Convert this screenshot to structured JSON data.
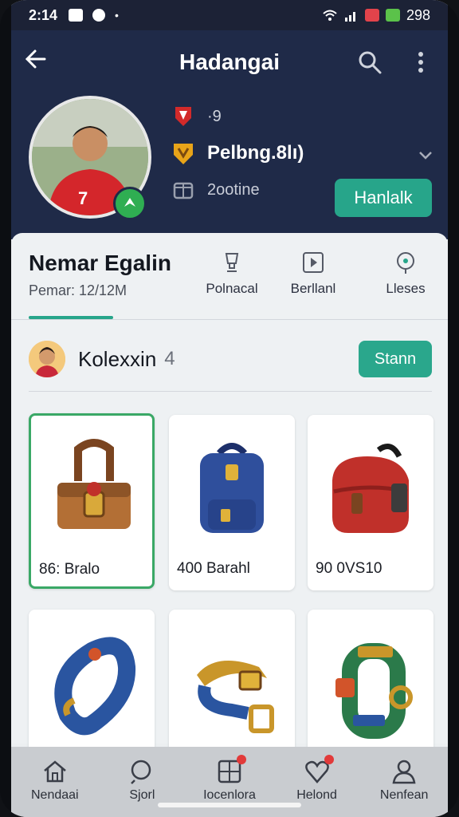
{
  "status_bar": {
    "time": "2:14",
    "battery": "298"
  },
  "header": {
    "title": "Hadangai",
    "follow_label": "Hanlalk"
  },
  "profile": {
    "line1": "·9",
    "line2": "Pelbng.8lı)",
    "line3": "2ootine",
    "jersey_number": "7",
    "name": "Nemar Egalin",
    "sub": "Pemar: 12/12M"
  },
  "tabs": [
    {
      "label": "Polnacal",
      "icon": "trophy-icon"
    },
    {
      "label": "Berllanl",
      "icon": "play-icon"
    },
    {
      "label": "Lleses",
      "icon": "badge-icon"
    }
  ],
  "collection": {
    "title": "Kolexxin",
    "count": "4",
    "button_label": "Stann"
  },
  "items": [
    {
      "label": "86: Bralo",
      "icon": "satchel-icon",
      "color": "#a0622d",
      "selected": true
    },
    {
      "label": "400 Barahl",
      "icon": "backpack-icon",
      "color": "#2f4f9c",
      "selected": false
    },
    {
      "label": "90 0VS10",
      "icon": "bag-icon",
      "color": "#c0302a",
      "selected": false
    },
    {
      "label": "",
      "icon": "bracelet-icon",
      "color": "#2a55a0",
      "selected": false
    },
    {
      "label": "",
      "icon": "wristband-icon",
      "color": "#c9962a",
      "selected": false
    },
    {
      "label": "",
      "icon": "armband-icon",
      "color": "#2b7a4a",
      "selected": false
    }
  ],
  "bottom_nav": [
    {
      "label": "Nendaai",
      "icon": "home-icon"
    },
    {
      "label": "Sjorl",
      "icon": "search-icon"
    },
    {
      "label": "Iocenlora",
      "icon": "grid-icon"
    },
    {
      "label": "Helond",
      "icon": "heart-icon"
    },
    {
      "label": "Nenfean",
      "icon": "profile-icon"
    }
  ],
  "colors": {
    "accent": "#27a58a",
    "header_bg": "#1f2a48",
    "selected_border": "#3aa866"
  }
}
